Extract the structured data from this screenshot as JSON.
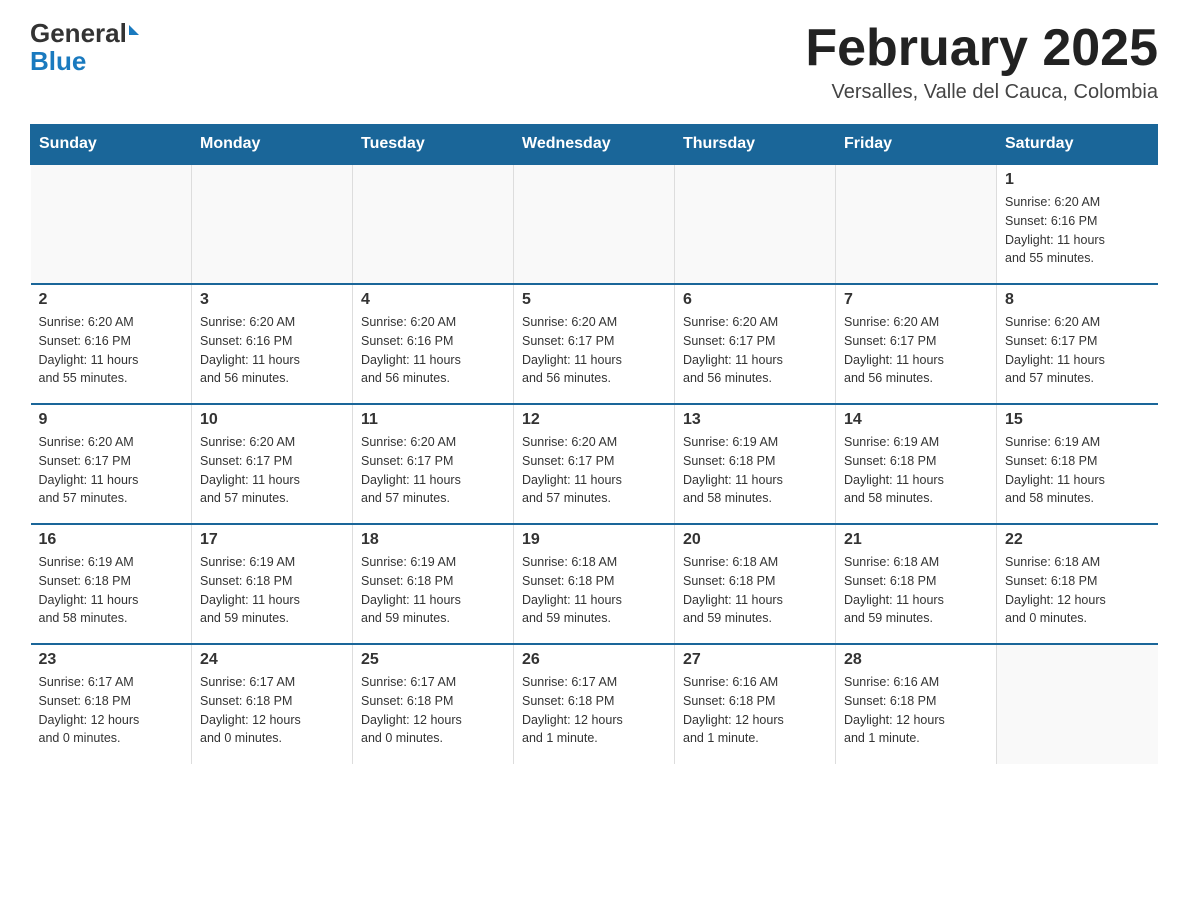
{
  "logo": {
    "general": "General",
    "blue": "Blue"
  },
  "header": {
    "title": "February 2025",
    "subtitle": "Versalles, Valle del Cauca, Colombia"
  },
  "days_header": [
    "Sunday",
    "Monday",
    "Tuesday",
    "Wednesday",
    "Thursday",
    "Friday",
    "Saturday"
  ],
  "weeks": [
    [
      {
        "day": "",
        "info": ""
      },
      {
        "day": "",
        "info": ""
      },
      {
        "day": "",
        "info": ""
      },
      {
        "day": "",
        "info": ""
      },
      {
        "day": "",
        "info": ""
      },
      {
        "day": "",
        "info": ""
      },
      {
        "day": "1",
        "info": "Sunrise: 6:20 AM\nSunset: 6:16 PM\nDaylight: 11 hours\nand 55 minutes."
      }
    ],
    [
      {
        "day": "2",
        "info": "Sunrise: 6:20 AM\nSunset: 6:16 PM\nDaylight: 11 hours\nand 55 minutes."
      },
      {
        "day": "3",
        "info": "Sunrise: 6:20 AM\nSunset: 6:16 PM\nDaylight: 11 hours\nand 56 minutes."
      },
      {
        "day": "4",
        "info": "Sunrise: 6:20 AM\nSunset: 6:16 PM\nDaylight: 11 hours\nand 56 minutes."
      },
      {
        "day": "5",
        "info": "Sunrise: 6:20 AM\nSunset: 6:17 PM\nDaylight: 11 hours\nand 56 minutes."
      },
      {
        "day": "6",
        "info": "Sunrise: 6:20 AM\nSunset: 6:17 PM\nDaylight: 11 hours\nand 56 minutes."
      },
      {
        "day": "7",
        "info": "Sunrise: 6:20 AM\nSunset: 6:17 PM\nDaylight: 11 hours\nand 56 minutes."
      },
      {
        "day": "8",
        "info": "Sunrise: 6:20 AM\nSunset: 6:17 PM\nDaylight: 11 hours\nand 57 minutes."
      }
    ],
    [
      {
        "day": "9",
        "info": "Sunrise: 6:20 AM\nSunset: 6:17 PM\nDaylight: 11 hours\nand 57 minutes."
      },
      {
        "day": "10",
        "info": "Sunrise: 6:20 AM\nSunset: 6:17 PM\nDaylight: 11 hours\nand 57 minutes."
      },
      {
        "day": "11",
        "info": "Sunrise: 6:20 AM\nSunset: 6:17 PM\nDaylight: 11 hours\nand 57 minutes."
      },
      {
        "day": "12",
        "info": "Sunrise: 6:20 AM\nSunset: 6:17 PM\nDaylight: 11 hours\nand 57 minutes."
      },
      {
        "day": "13",
        "info": "Sunrise: 6:19 AM\nSunset: 6:18 PM\nDaylight: 11 hours\nand 58 minutes."
      },
      {
        "day": "14",
        "info": "Sunrise: 6:19 AM\nSunset: 6:18 PM\nDaylight: 11 hours\nand 58 minutes."
      },
      {
        "day": "15",
        "info": "Sunrise: 6:19 AM\nSunset: 6:18 PM\nDaylight: 11 hours\nand 58 minutes."
      }
    ],
    [
      {
        "day": "16",
        "info": "Sunrise: 6:19 AM\nSunset: 6:18 PM\nDaylight: 11 hours\nand 58 minutes."
      },
      {
        "day": "17",
        "info": "Sunrise: 6:19 AM\nSunset: 6:18 PM\nDaylight: 11 hours\nand 59 minutes."
      },
      {
        "day": "18",
        "info": "Sunrise: 6:19 AM\nSunset: 6:18 PM\nDaylight: 11 hours\nand 59 minutes."
      },
      {
        "day": "19",
        "info": "Sunrise: 6:18 AM\nSunset: 6:18 PM\nDaylight: 11 hours\nand 59 minutes."
      },
      {
        "day": "20",
        "info": "Sunrise: 6:18 AM\nSunset: 6:18 PM\nDaylight: 11 hours\nand 59 minutes."
      },
      {
        "day": "21",
        "info": "Sunrise: 6:18 AM\nSunset: 6:18 PM\nDaylight: 11 hours\nand 59 minutes."
      },
      {
        "day": "22",
        "info": "Sunrise: 6:18 AM\nSunset: 6:18 PM\nDaylight: 12 hours\nand 0 minutes."
      }
    ],
    [
      {
        "day": "23",
        "info": "Sunrise: 6:17 AM\nSunset: 6:18 PM\nDaylight: 12 hours\nand 0 minutes."
      },
      {
        "day": "24",
        "info": "Sunrise: 6:17 AM\nSunset: 6:18 PM\nDaylight: 12 hours\nand 0 minutes."
      },
      {
        "day": "25",
        "info": "Sunrise: 6:17 AM\nSunset: 6:18 PM\nDaylight: 12 hours\nand 0 minutes."
      },
      {
        "day": "26",
        "info": "Sunrise: 6:17 AM\nSunset: 6:18 PM\nDaylight: 12 hours\nand 1 minute."
      },
      {
        "day": "27",
        "info": "Sunrise: 6:16 AM\nSunset: 6:18 PM\nDaylight: 12 hours\nand 1 minute."
      },
      {
        "day": "28",
        "info": "Sunrise: 6:16 AM\nSunset: 6:18 PM\nDaylight: 12 hours\nand 1 minute."
      },
      {
        "day": "",
        "info": ""
      }
    ]
  ]
}
